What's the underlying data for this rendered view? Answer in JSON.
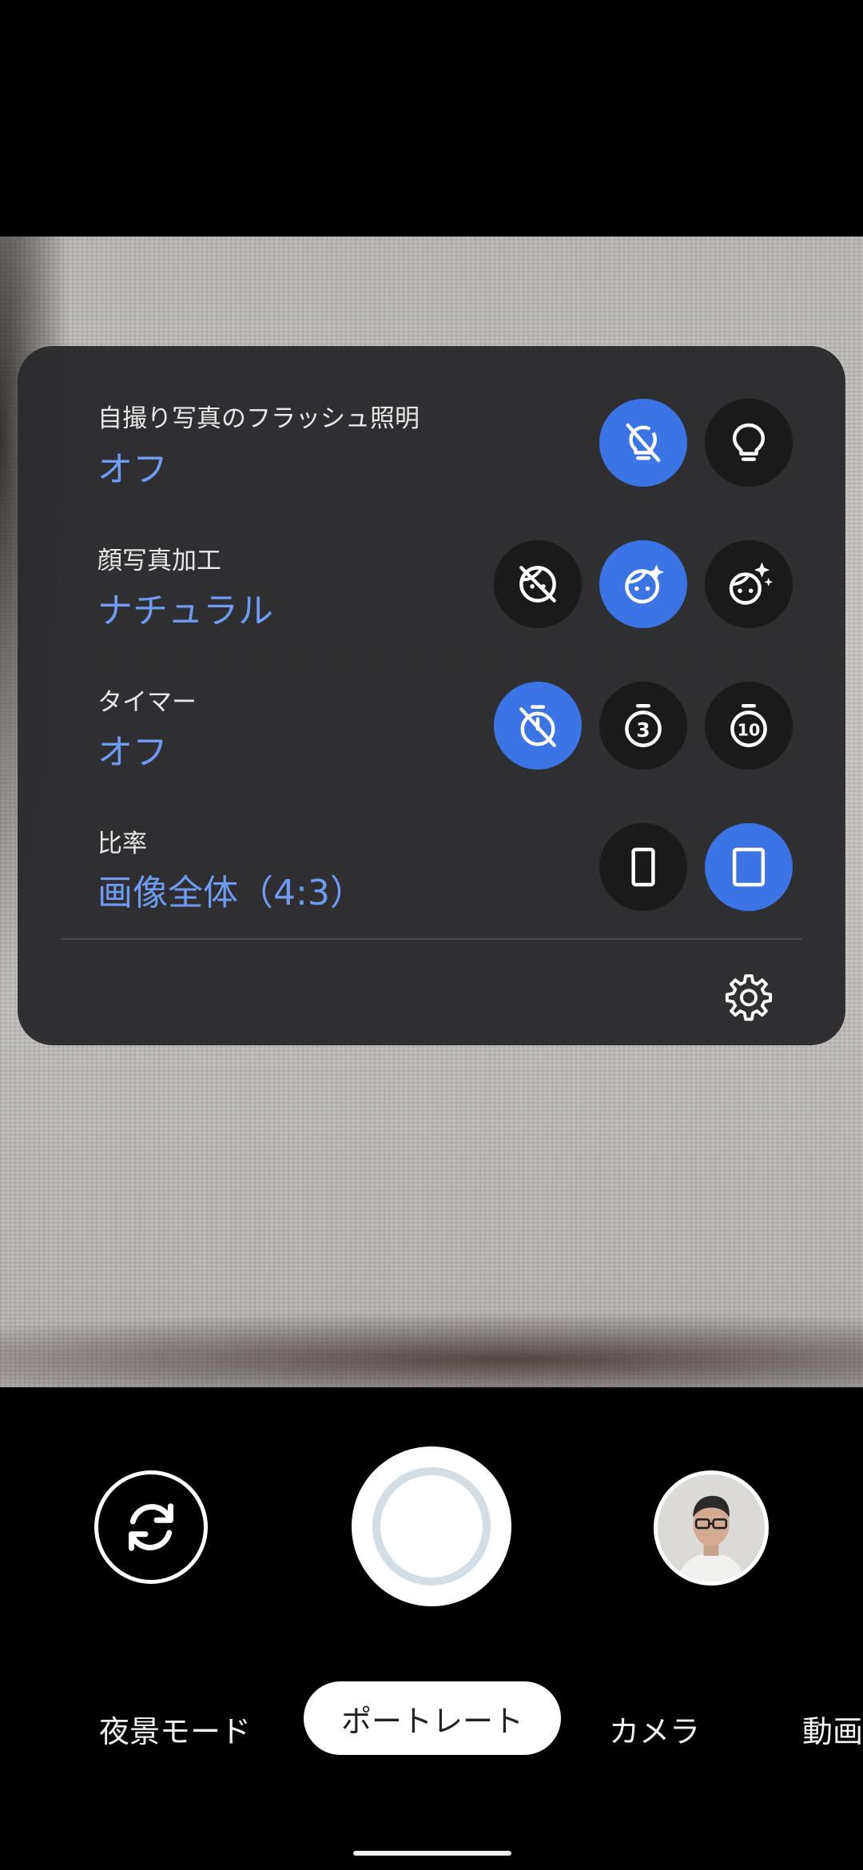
{
  "settings": {
    "rows": [
      {
        "label": "自撮り写真のフラッシュ照明",
        "value": "オフ"
      },
      {
        "label": "顔写真加工",
        "value": "ナチュラル"
      },
      {
        "label": "タイマー",
        "value": "オフ"
      },
      {
        "label": "比率",
        "value": "画像全体（4:3）"
      }
    ],
    "options": {
      "flash": [
        "flash-off-icon",
        "bulb-icon"
      ],
      "retouch": [
        "retouch-off-icon",
        "retouch-natural-icon",
        "retouch-smooth-icon"
      ],
      "timer": [
        "timer-off-icon",
        "timer-3s-icon",
        "timer-10s-icon"
      ],
      "ratio": [
        "ratio-full-icon",
        "ratio-4-3-icon"
      ]
    },
    "selected": {
      "flash": 0,
      "retouch": 1,
      "timer": 0,
      "ratio": 1
    },
    "timer_3": "3",
    "timer_10": "10"
  },
  "modes": {
    "items": [
      "夜景モード",
      "ポートレート",
      "カメラ",
      "動画"
    ],
    "active": "ポートレート"
  },
  "colors": {
    "accent": "#3b74e4",
    "value_text": "#6f9bf2",
    "panel": "#2a2a2c"
  }
}
